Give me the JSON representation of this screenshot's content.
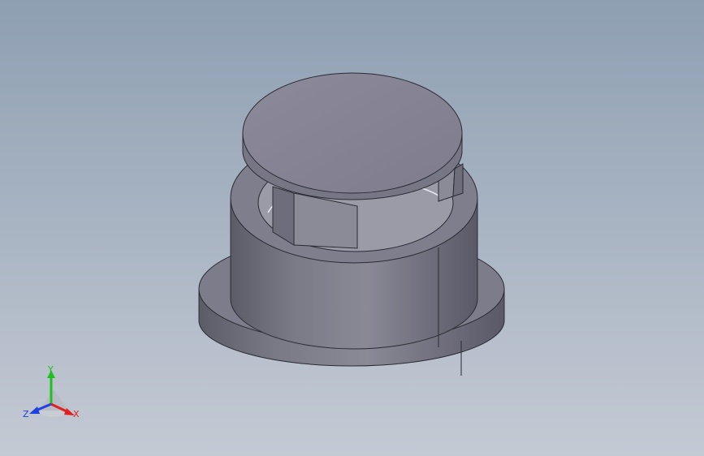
{
  "viewport": {
    "background_top": "#8e9fb2",
    "background_bottom": "#c4cad4",
    "model_color": "#7c7b8a"
  },
  "triad": {
    "x_label": "X",
    "y_label": "Y",
    "z_label": "Z",
    "x_color": "#e02020",
    "y_color": "#20c020",
    "z_color": "#2040e0"
  }
}
